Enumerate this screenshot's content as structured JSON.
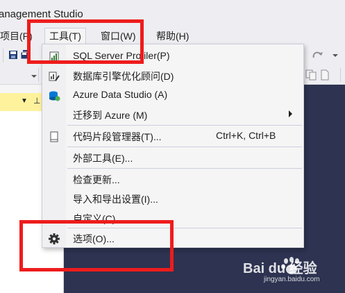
{
  "window": {
    "title": "anagement Studio"
  },
  "menubar": {
    "items": [
      {
        "label": "项目(P)"
      },
      {
        "label": "工具(T)"
      },
      {
        "label": "窗口(W)"
      },
      {
        "label": "帮助(H)"
      }
    ]
  },
  "tools_menu": {
    "items": [
      {
        "label": "SQL Server Profiler(P)",
        "icon": "profiler-icon"
      },
      {
        "label": "数据库引擎优化顾问(D)",
        "icon": "tuning-advisor-icon"
      },
      {
        "label": "Azure Data Studio (A)",
        "icon": "azure-data-studio-icon"
      },
      {
        "label": "迁移到 Azure (M)",
        "has_submenu": true
      },
      {
        "label": "代码片段管理器(T)...",
        "shortcut": "Ctrl+K, Ctrl+B",
        "icon": "snippet-manager-icon"
      },
      {
        "label": "外部工具(E)..."
      },
      {
        "label": "检查更新..."
      },
      {
        "label": "导入和导出设置(I)..."
      },
      {
        "label": "自定义(C)..."
      },
      {
        "label": "选项(O)...",
        "icon": "gear-icon"
      }
    ]
  },
  "watermark": {
    "brand": "Bai du 经验",
    "url": "jingyan.baidu.com"
  },
  "colors": {
    "highlight": "#ee1c1c",
    "document_bg": "#2d3350",
    "panel_header": "#fff29d"
  }
}
